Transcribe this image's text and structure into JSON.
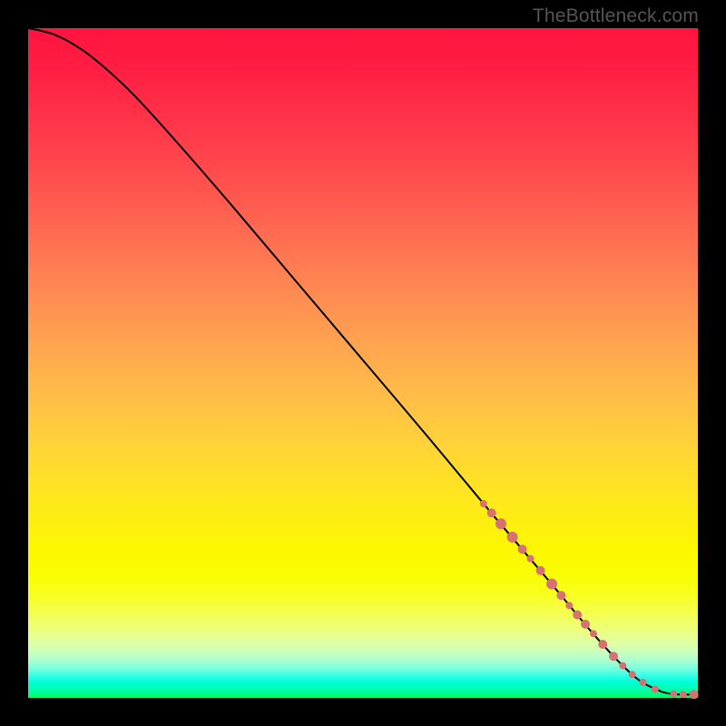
{
  "watermark": "TheBottleneck.com",
  "colors": {
    "curve_stroke": "#000000",
    "marker_fill": "#d67272",
    "bg": "#000000"
  },
  "chart_data": {
    "type": "line",
    "title": "",
    "xlabel": "",
    "ylabel": "",
    "xlim": [
      0,
      100
    ],
    "ylim": [
      0,
      100
    ],
    "grid": false,
    "legend": false,
    "curve": [
      {
        "x": 0.0,
        "y": 100.0
      },
      {
        "x": 4.0,
        "y": 99.0
      },
      {
        "x": 8.0,
        "y": 96.8
      },
      {
        "x": 12.0,
        "y": 93.6
      },
      {
        "x": 16.0,
        "y": 89.8
      },
      {
        "x": 22.0,
        "y": 83.2
      },
      {
        "x": 30.0,
        "y": 74.0
      },
      {
        "x": 40.0,
        "y": 62.2
      },
      {
        "x": 50.0,
        "y": 50.4
      },
      {
        "x": 60.0,
        "y": 38.6
      },
      {
        "x": 70.0,
        "y": 26.6
      },
      {
        "x": 78.0,
        "y": 17.2
      },
      {
        "x": 84.0,
        "y": 10.0
      },
      {
        "x": 88.0,
        "y": 5.6
      },
      {
        "x": 91.0,
        "y": 2.8
      },
      {
        "x": 93.5,
        "y": 1.4
      },
      {
        "x": 96.0,
        "y": 0.6
      },
      {
        "x": 100.0,
        "y": 0.5
      }
    ],
    "markers": [
      {
        "x": 68.0,
        "y": 29.0,
        "r": 4
      },
      {
        "x": 69.2,
        "y": 27.6,
        "r": 5
      },
      {
        "x": 70.6,
        "y": 26.0,
        "r": 6
      },
      {
        "x": 72.3,
        "y": 24.0,
        "r": 6
      },
      {
        "x": 73.8,
        "y": 22.2,
        "r": 5
      },
      {
        "x": 75.0,
        "y": 20.8,
        "r": 4
      },
      {
        "x": 76.5,
        "y": 19.0,
        "r": 5
      },
      {
        "x": 78.2,
        "y": 17.0,
        "r": 6
      },
      {
        "x": 79.6,
        "y": 15.3,
        "r": 5
      },
      {
        "x": 80.8,
        "y": 13.8,
        "r": 4
      },
      {
        "x": 82.0,
        "y": 12.4,
        "r": 5
      },
      {
        "x": 83.2,
        "y": 11.0,
        "r": 5
      },
      {
        "x": 84.4,
        "y": 9.6,
        "r": 4
      },
      {
        "x": 85.8,
        "y": 8.0,
        "r": 5
      },
      {
        "x": 87.4,
        "y": 6.2,
        "r": 5
      },
      {
        "x": 88.8,
        "y": 4.8,
        "r": 4
      },
      {
        "x": 90.2,
        "y": 3.5,
        "r": 4
      },
      {
        "x": 91.8,
        "y": 2.3,
        "r": 4
      },
      {
        "x": 93.6,
        "y": 1.3,
        "r": 4
      },
      {
        "x": 96.4,
        "y": 0.6,
        "r": 4
      },
      {
        "x": 97.8,
        "y": 0.5,
        "r": 4
      },
      {
        "x": 99.4,
        "y": 0.5,
        "r": 5
      }
    ]
  }
}
